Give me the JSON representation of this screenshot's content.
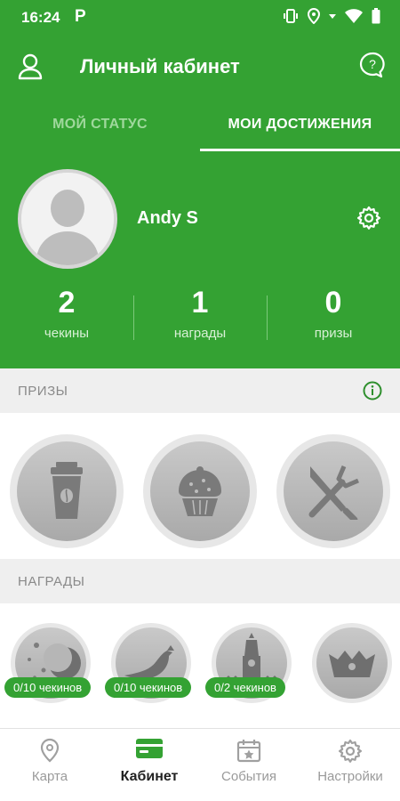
{
  "status_bar": {
    "time": "16:24",
    "app_icon": "P"
  },
  "header": {
    "title": "Личный кабинет"
  },
  "tabs": [
    {
      "label": "МОЙ СТАТУС"
    },
    {
      "label": "МОИ ДОСТИЖЕНИЯ"
    }
  ],
  "profile": {
    "name": "Andy S",
    "stats": [
      {
        "value": "2",
        "label": "чекины"
      },
      {
        "value": "1",
        "label": "награды"
      },
      {
        "value": "0",
        "label": "призы"
      }
    ]
  },
  "prizes": {
    "title": "ПРИЗЫ",
    "items": [
      {
        "icon": "coffee-cup-icon"
      },
      {
        "icon": "cupcake-icon"
      },
      {
        "icon": "fork-knife-icon"
      }
    ]
  },
  "awards": {
    "title": "НАГРАДЫ",
    "items": [
      {
        "icon": "moon-icon",
        "progress": "0/10 чекинов"
      },
      {
        "icon": "bird-icon",
        "progress": "0/10 чекинов"
      },
      {
        "icon": "kremlin-tower-icon",
        "progress": "0/2 чекинов"
      },
      {
        "icon": "crown-icon"
      }
    ]
  },
  "bottom_nav": [
    {
      "label": "Карта",
      "icon": "map-pin-icon"
    },
    {
      "label": "Кабинет",
      "icon": "wallet-icon"
    },
    {
      "label": "События",
      "icon": "calendar-icon"
    },
    {
      "label": "Настройки",
      "icon": "gear-icon"
    }
  ],
  "colors": {
    "primary": "#34a233",
    "badge_gray": "#b4b4b4"
  }
}
